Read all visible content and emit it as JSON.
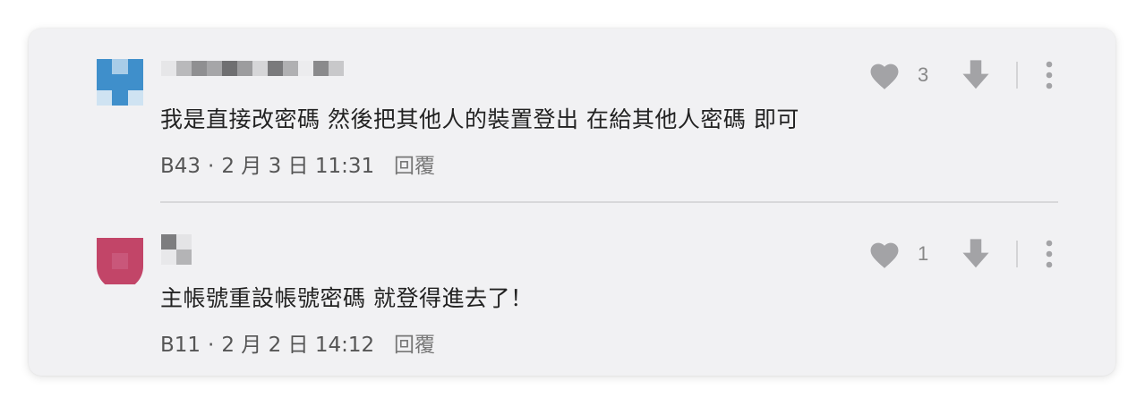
{
  "comments": [
    {
      "text": "我是直接改密碼 然後把其他人的裝置登出 在給其他人密碼 即可",
      "floor": "B43",
      "separator": "·",
      "datetime": "2 月 3 日 11:31",
      "reply_label": "回覆",
      "like_count": "3",
      "avatar_color": "#3f8fcb",
      "icons": {
        "like": "heart-icon",
        "dislike": "down-arrow-icon",
        "more": "more-vertical-icon"
      }
    },
    {
      "text": "主帳號重設帳號密碼 就登得進去了！",
      "floor": "B11",
      "separator": "·",
      "datetime": "2 月 2 日 14:12",
      "reply_label": "回覆",
      "like_count": "1",
      "avatar_color": "#c24568",
      "icons": {
        "like": "heart-icon",
        "dislike": "down-arrow-icon",
        "more": "more-vertical-icon"
      }
    }
  ],
  "colors": {
    "card_background": "#f1f1f3",
    "icon_gray": "#a3a3a6",
    "text_primary": "#222222",
    "text_secondary": "#555555"
  }
}
